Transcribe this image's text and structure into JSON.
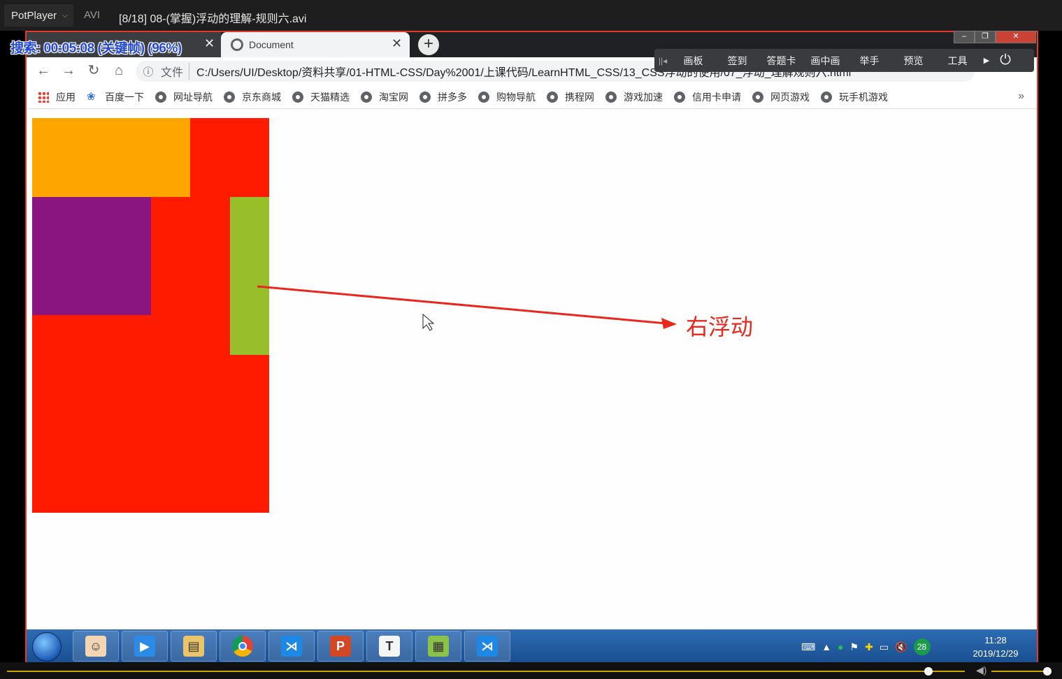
{
  "player": {
    "brand": "PotPlayer",
    "format": "AVI",
    "file_title": "[8/18] 08-(掌握)浮动的理解-规则六.avi",
    "osd_text": "搜索: 00:05:08 (关键帧) (96%)"
  },
  "browser": {
    "active_tab_title": "Document",
    "address_label": "文件",
    "url": "C:/Users/UI/Desktop/资料共享/01-HTML-CSS/Day%2001/上课代码/LearnHTML_CSS/13_CSS浮动的使用/07_浮动_理解规则六.html",
    "bookmarks": [
      "应用",
      "百度一下",
      "网址导航",
      "京东商城",
      "天猫精选",
      "淘宝网",
      "拼多多",
      "购物导航",
      "携程网",
      "游戏加速",
      "信用卡申请",
      "网页游戏",
      "玩手机游戏"
    ]
  },
  "classroom_toolbar": {
    "items": [
      "画板",
      "签到",
      "答题卡",
      "画中画",
      "举手",
      "预览",
      "工具"
    ]
  },
  "page": {
    "annotation": "右浮动",
    "colors": {
      "container": "#fe1b00",
      "orange": "#ffa500",
      "purple": "#8b1580",
      "green": "#98bf2a",
      "annotation": "#e8281c"
    }
  },
  "taskbar": {
    "time": "11:28",
    "date": "2019/12/29",
    "badge": "28"
  }
}
